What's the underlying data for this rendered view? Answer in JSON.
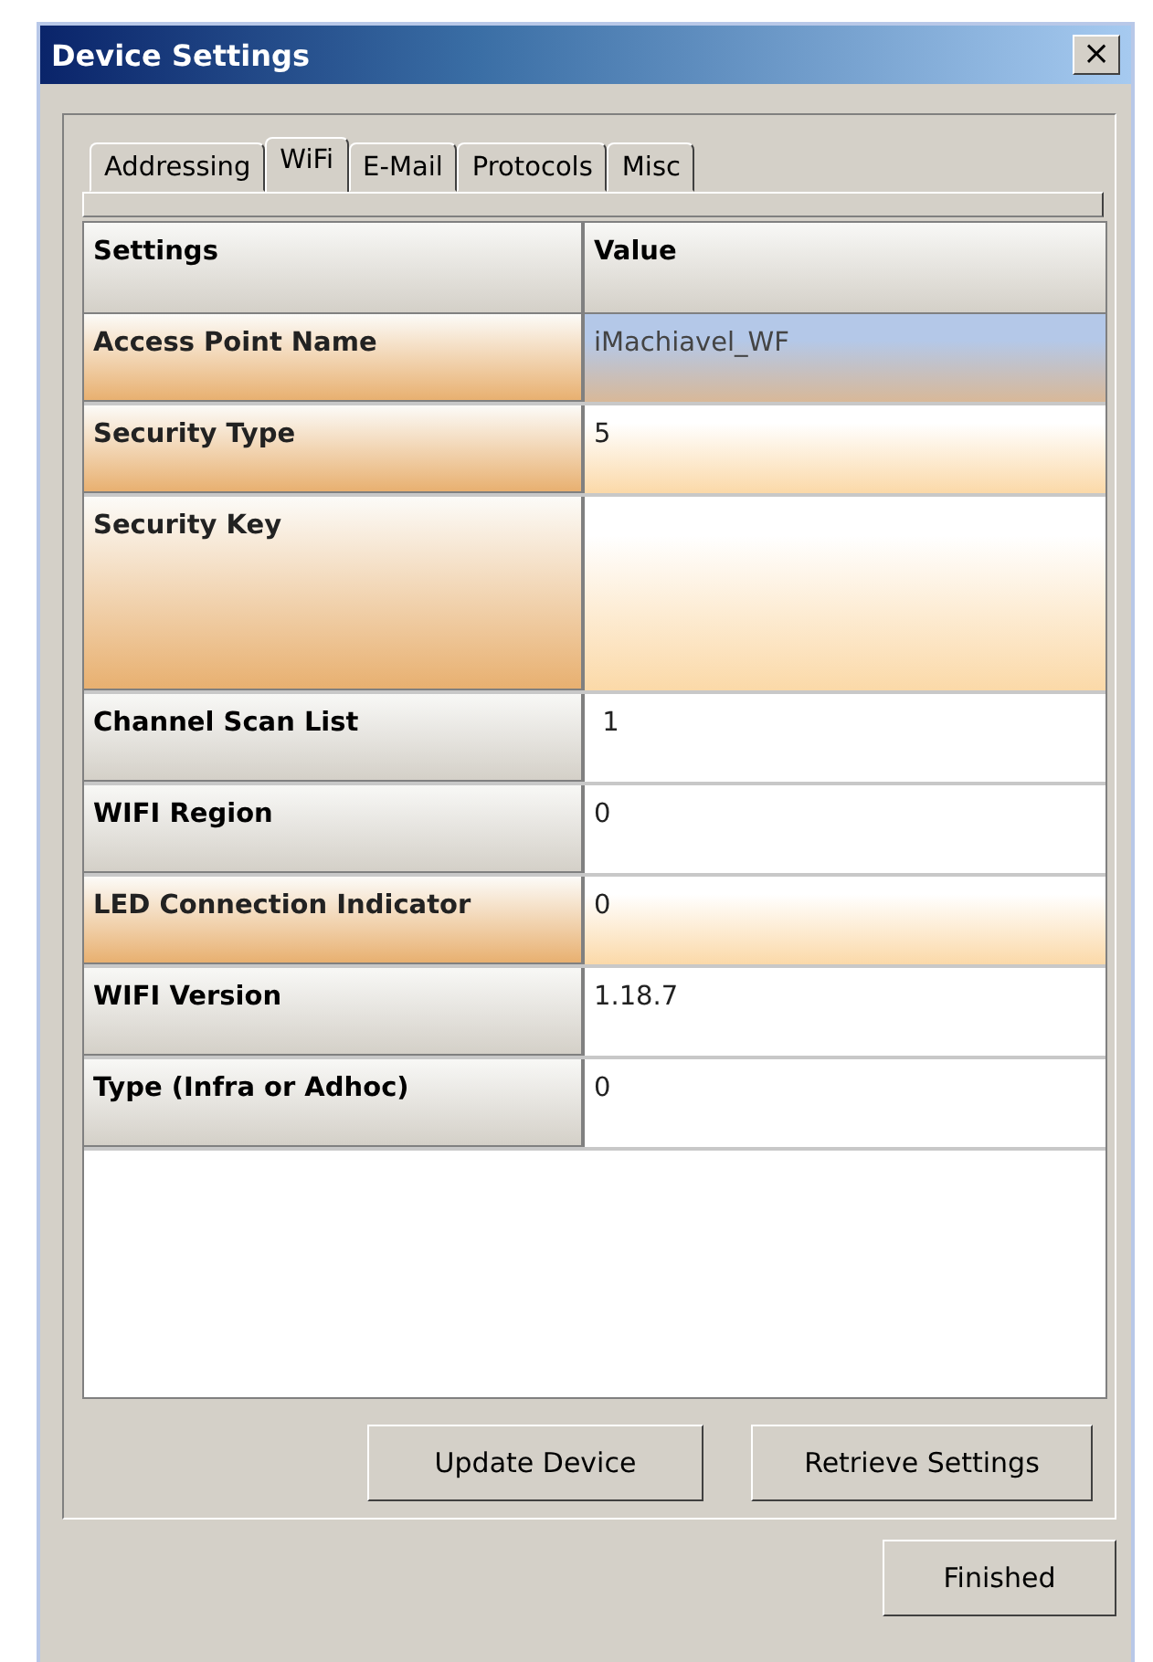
{
  "window": {
    "title": "Device Settings",
    "close": "×"
  },
  "tabs": [
    {
      "label": "Addressing",
      "selected": false
    },
    {
      "label": "WiFi",
      "selected": true
    },
    {
      "label": "E-Mail",
      "selected": false
    },
    {
      "label": "Protocols",
      "selected": false
    },
    {
      "label": "Misc",
      "selected": false
    }
  ],
  "table": {
    "columns": [
      "Settings",
      "Value"
    ],
    "rows": [
      {
        "setting": "Access Point Name",
        "value": "iMachiavel_WF",
        "selected": true,
        "highlighted": true,
        "kind": "single"
      },
      {
        "setting": "Security Type",
        "value": "5",
        "selected": false,
        "highlighted": true,
        "kind": "single"
      },
      {
        "setting": "Security Key",
        "value": "",
        "selected": false,
        "highlighted": true,
        "kind": "multiline"
      },
      {
        "setting": "Channel Scan List",
        "value": " 1",
        "selected": false,
        "highlighted": false,
        "kind": "single"
      },
      {
        "setting": "WIFI Region",
        "value": "0",
        "selected": false,
        "highlighted": false,
        "kind": "single"
      },
      {
        "setting": "LED Connection Indicator",
        "value": "0",
        "selected": false,
        "highlighted": true,
        "kind": "single"
      },
      {
        "setting": "WIFI Version",
        "value": "1.18.7",
        "selected": false,
        "highlighted": false,
        "kind": "single"
      },
      {
        "setting": "Type (Infra or Adhoc)",
        "value": "0",
        "selected": false,
        "highlighted": false,
        "kind": "single"
      }
    ]
  },
  "buttons": [
    "Update Device",
    "Retrieve Settings"
  ],
  "footer_button": "Finished"
}
